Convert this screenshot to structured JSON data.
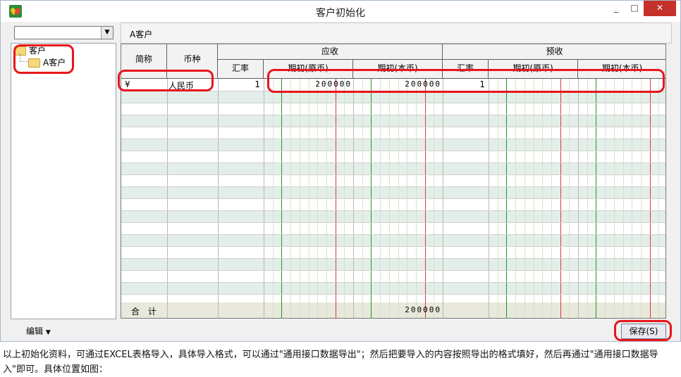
{
  "window": {
    "title": "客户初始化"
  },
  "controls": {
    "minimize": "_",
    "maximize": "□",
    "close": "✕"
  },
  "left": {
    "combo_value": "",
    "tree": {
      "root": "客户",
      "child": "A客户"
    }
  },
  "right": {
    "header": "A客户"
  },
  "grid": {
    "headers": {
      "code": "简称",
      "currency": "币种",
      "receivable": "应收",
      "prepaid": "预收",
      "rate": "汇率",
      "orig": "期初(原币)",
      "local": "期初(本币)"
    },
    "row1": {
      "code": "¥",
      "currency": "人民币",
      "recv_rate": "1",
      "recv_orig": "200000",
      "recv_local": "200000",
      "pre_rate": "1",
      "pre_orig": "",
      "pre_local": ""
    },
    "total": {
      "label": "合 计",
      "recv_local": "200000"
    }
  },
  "footer": {
    "edit_label": "编辑",
    "save_label": "保存(S)"
  },
  "caption": "以上初始化资料，可通过EXCEL表格导入，具体导入格式，可以通过\"通用接口数据导出\"；然后把要导入的内容按照导出的格式填好，然后再通过\"通用接口数据导入\"即可。具体位置如图：",
  "colors": {
    "highlight": "#e8151c",
    "green_line": "#1a9a1a",
    "red_line": "#d63a3a"
  }
}
